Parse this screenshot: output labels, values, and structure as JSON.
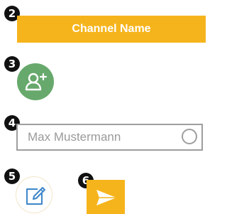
{
  "steps": {
    "step2": "2",
    "step3": "3",
    "step4": "4",
    "step5": "5",
    "step6": "6"
  },
  "channel": {
    "name": "Channel Name"
  },
  "add_user": {
    "icon": "add-user-icon"
  },
  "name_input": {
    "value": "Max Mustermann"
  },
  "edit": {
    "icon": "edit-icon"
  },
  "send": {
    "icon": "send-icon"
  },
  "colors": {
    "accent_yellow": "#F6B41C",
    "green": "#67A96C",
    "border_gray": "#9E9E9E",
    "badge_black": "#111111",
    "edit_blue": "#3E86C8"
  }
}
